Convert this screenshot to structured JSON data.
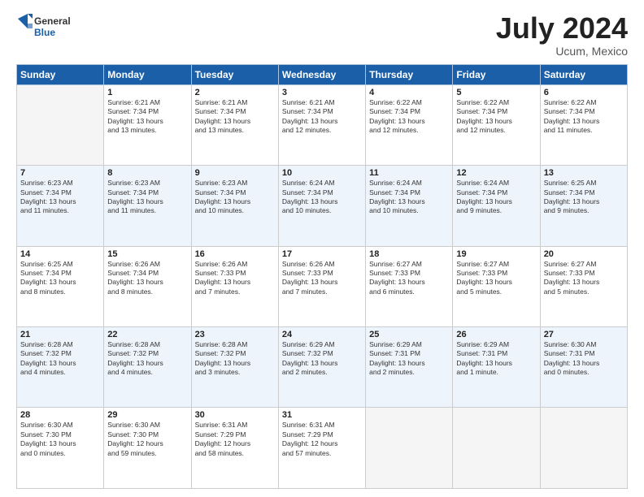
{
  "header": {
    "logo_line1": "General",
    "logo_line2": "Blue",
    "month": "July 2024",
    "location": "Ucum, Mexico"
  },
  "weekdays": [
    "Sunday",
    "Monday",
    "Tuesday",
    "Wednesday",
    "Thursday",
    "Friday",
    "Saturday"
  ],
  "weeks": [
    [
      {
        "day": "",
        "info": ""
      },
      {
        "day": "1",
        "info": "Sunrise: 6:21 AM\nSunset: 7:34 PM\nDaylight: 13 hours\nand 13 minutes."
      },
      {
        "day": "2",
        "info": "Sunrise: 6:21 AM\nSunset: 7:34 PM\nDaylight: 13 hours\nand 13 minutes."
      },
      {
        "day": "3",
        "info": "Sunrise: 6:21 AM\nSunset: 7:34 PM\nDaylight: 13 hours\nand 12 minutes."
      },
      {
        "day": "4",
        "info": "Sunrise: 6:22 AM\nSunset: 7:34 PM\nDaylight: 13 hours\nand 12 minutes."
      },
      {
        "day": "5",
        "info": "Sunrise: 6:22 AM\nSunset: 7:34 PM\nDaylight: 13 hours\nand 12 minutes."
      },
      {
        "day": "6",
        "info": "Sunrise: 6:22 AM\nSunset: 7:34 PM\nDaylight: 13 hours\nand 11 minutes."
      }
    ],
    [
      {
        "day": "7",
        "info": "Sunrise: 6:23 AM\nSunset: 7:34 PM\nDaylight: 13 hours\nand 11 minutes."
      },
      {
        "day": "8",
        "info": "Sunrise: 6:23 AM\nSunset: 7:34 PM\nDaylight: 13 hours\nand 11 minutes."
      },
      {
        "day": "9",
        "info": "Sunrise: 6:23 AM\nSunset: 7:34 PM\nDaylight: 13 hours\nand 10 minutes."
      },
      {
        "day": "10",
        "info": "Sunrise: 6:24 AM\nSunset: 7:34 PM\nDaylight: 13 hours\nand 10 minutes."
      },
      {
        "day": "11",
        "info": "Sunrise: 6:24 AM\nSunset: 7:34 PM\nDaylight: 13 hours\nand 10 minutes."
      },
      {
        "day": "12",
        "info": "Sunrise: 6:24 AM\nSunset: 7:34 PM\nDaylight: 13 hours\nand 9 minutes."
      },
      {
        "day": "13",
        "info": "Sunrise: 6:25 AM\nSunset: 7:34 PM\nDaylight: 13 hours\nand 9 minutes."
      }
    ],
    [
      {
        "day": "14",
        "info": "Sunrise: 6:25 AM\nSunset: 7:34 PM\nDaylight: 13 hours\nand 8 minutes."
      },
      {
        "day": "15",
        "info": "Sunrise: 6:26 AM\nSunset: 7:34 PM\nDaylight: 13 hours\nand 8 minutes."
      },
      {
        "day": "16",
        "info": "Sunrise: 6:26 AM\nSunset: 7:33 PM\nDaylight: 13 hours\nand 7 minutes."
      },
      {
        "day": "17",
        "info": "Sunrise: 6:26 AM\nSunset: 7:33 PM\nDaylight: 13 hours\nand 7 minutes."
      },
      {
        "day": "18",
        "info": "Sunrise: 6:27 AM\nSunset: 7:33 PM\nDaylight: 13 hours\nand 6 minutes."
      },
      {
        "day": "19",
        "info": "Sunrise: 6:27 AM\nSunset: 7:33 PM\nDaylight: 13 hours\nand 5 minutes."
      },
      {
        "day": "20",
        "info": "Sunrise: 6:27 AM\nSunset: 7:33 PM\nDaylight: 13 hours\nand 5 minutes."
      }
    ],
    [
      {
        "day": "21",
        "info": "Sunrise: 6:28 AM\nSunset: 7:32 PM\nDaylight: 13 hours\nand 4 minutes."
      },
      {
        "day": "22",
        "info": "Sunrise: 6:28 AM\nSunset: 7:32 PM\nDaylight: 13 hours\nand 4 minutes."
      },
      {
        "day": "23",
        "info": "Sunrise: 6:28 AM\nSunset: 7:32 PM\nDaylight: 13 hours\nand 3 minutes."
      },
      {
        "day": "24",
        "info": "Sunrise: 6:29 AM\nSunset: 7:32 PM\nDaylight: 13 hours\nand 2 minutes."
      },
      {
        "day": "25",
        "info": "Sunrise: 6:29 AM\nSunset: 7:31 PM\nDaylight: 13 hours\nand 2 minutes."
      },
      {
        "day": "26",
        "info": "Sunrise: 6:29 AM\nSunset: 7:31 PM\nDaylight: 13 hours\nand 1 minute."
      },
      {
        "day": "27",
        "info": "Sunrise: 6:30 AM\nSunset: 7:31 PM\nDaylight: 13 hours\nand 0 minutes."
      }
    ],
    [
      {
        "day": "28",
        "info": "Sunrise: 6:30 AM\nSunset: 7:30 PM\nDaylight: 13 hours\nand 0 minutes."
      },
      {
        "day": "29",
        "info": "Sunrise: 6:30 AM\nSunset: 7:30 PM\nDaylight: 12 hours\nand 59 minutes."
      },
      {
        "day": "30",
        "info": "Sunrise: 6:31 AM\nSunset: 7:29 PM\nDaylight: 12 hours\nand 58 minutes."
      },
      {
        "day": "31",
        "info": "Sunrise: 6:31 AM\nSunset: 7:29 PM\nDaylight: 12 hours\nand 57 minutes."
      },
      {
        "day": "",
        "info": ""
      },
      {
        "day": "",
        "info": ""
      },
      {
        "day": "",
        "info": ""
      }
    ]
  ]
}
